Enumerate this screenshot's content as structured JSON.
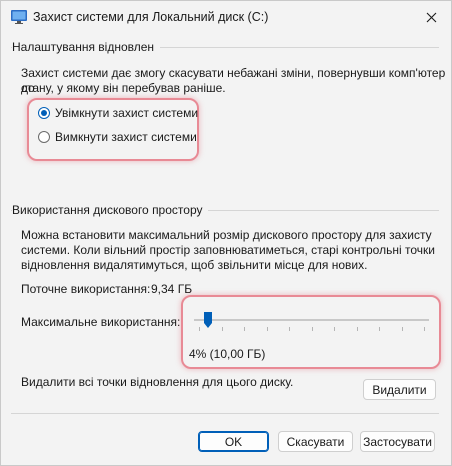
{
  "window": {
    "title": "Захист системи для Локальний диск (C:)"
  },
  "restore": {
    "group_title": "Налаштування відновлен",
    "description_line1": "Захист системи дає змогу скасувати небажані зміни, повернувши комп'ютер до",
    "description_line2": "стану, у якому він перебував раніше.",
    "option_on": "Увімкнути захист системи",
    "option_off": "Вимкнути захист системи",
    "selected": "on"
  },
  "disk": {
    "group_title": "Використання дискового простору",
    "description_line1": "Можна встановити максимальний розмір дискового простору для захисту",
    "description_line2": "системи. Коли вільний простір заповнюватиметься, старі контрольні точки",
    "description_line3": "відновлення видалятимуться, щоб звільнити місце для нових.",
    "current_label": "Поточне використання:",
    "current_value": "9,34 ГБ",
    "max_label": "Максимальне використання:",
    "slider_percent": 4,
    "slider_value_text": "4% (10,00 ГБ)",
    "delete_text": "Видалити всі точки відновлення для цього диску.",
    "delete_button": "Видалити"
  },
  "buttons": {
    "ok": "OK",
    "cancel": "Скасувати",
    "apply": "Застосувати"
  },
  "colors": {
    "accent": "#005fb8",
    "highlight": "#e88a95"
  }
}
